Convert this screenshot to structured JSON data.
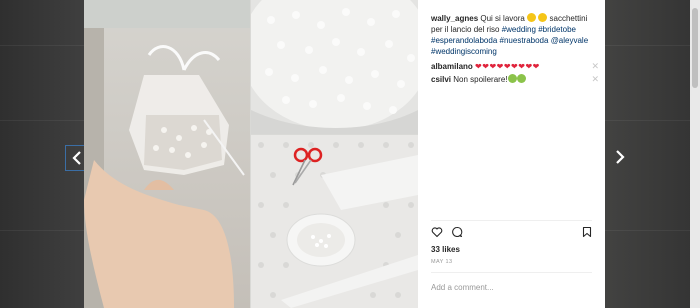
{
  "post": {
    "caption": {
      "username": "wally_agnes",
      "text_before": " Qui si lavora ",
      "text_after": " sacchettini per il lancio del riso ",
      "hashtags": [
        "#wedding",
        "#bridetobe",
        "#esperandolaboda",
        "#nuestraboda",
        "@aleyvale",
        "#weddingiscoming"
      ]
    },
    "comments": [
      {
        "username": "albamilano",
        "text": "❤❤❤❤❤❤❤❤❤"
      },
      {
        "username": "csilvi",
        "text": "Non spoilerare!"
      }
    ],
    "likes": "33 likes",
    "date": "MAY 13",
    "add_comment_placeholder": "Add a comment..."
  },
  "icons": {
    "like": "heart-icon",
    "comment": "comment-bubble-icon",
    "save": "bookmark-icon",
    "delete_comment": "close-icon",
    "prev": "chevron-left-icon",
    "next": "chevron-right-icon"
  },
  "colors": {
    "link": "#003569",
    "hearts": "#e0243c",
    "muted": "#999999"
  }
}
